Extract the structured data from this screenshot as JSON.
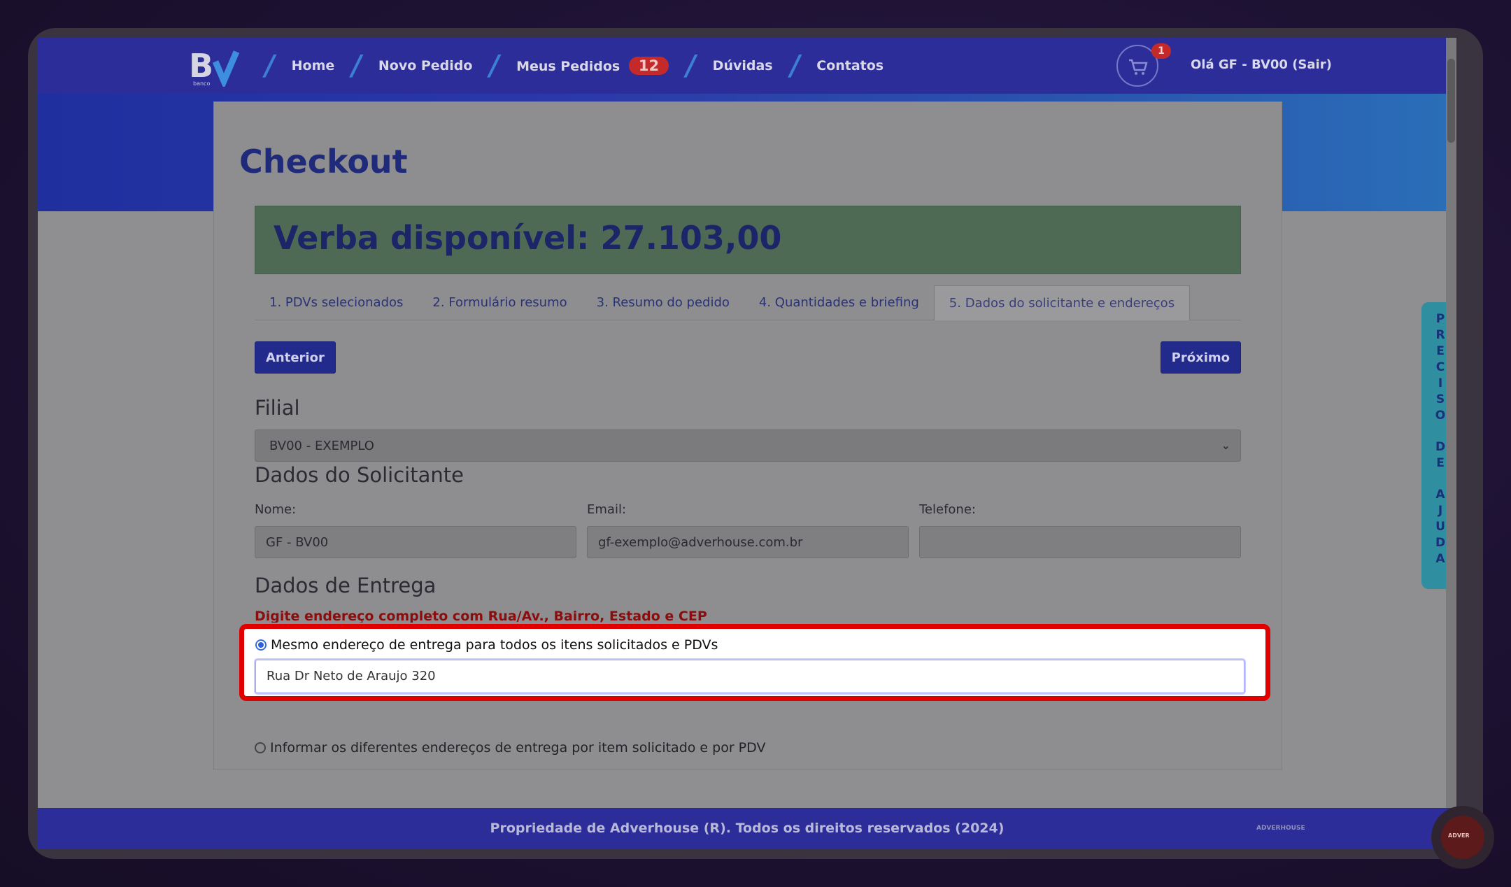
{
  "nav": {
    "logo_text": "banco",
    "items": [
      {
        "label": "Home"
      },
      {
        "label": "Novo Pedido"
      },
      {
        "label": "Meus Pedidos",
        "badge": "12"
      },
      {
        "label": "Dúvidas"
      },
      {
        "label": "Contatos"
      }
    ],
    "cart_count": "1",
    "greeting": "Olá GF - BV00 (Sair)"
  },
  "page": {
    "title": "Checkout",
    "verba": "Verba disponível: 27.103,00",
    "tabs": [
      "1. PDVs selecionados",
      "2. Formulário resumo",
      "3. Resumo do pedido",
      "4. Quantidades e briefing",
      "5. Dados do solicitante e endereços"
    ],
    "active_tab": 4,
    "prev_label": "Anterior",
    "next_label": "Próximo"
  },
  "filial": {
    "heading": "Filial",
    "selected": "BV00 - EXEMPLO"
  },
  "solicitante": {
    "heading": "Dados do Solicitante",
    "nome_label": "Nome:",
    "nome_value": "GF - BV00",
    "email_label": "Email:",
    "email_value": "gf-exemplo@adverhouse.com.br",
    "telefone_label": "Telefone:",
    "telefone_value": ""
  },
  "entrega": {
    "heading": "Dados de Entrega",
    "warning": "Digite endereço completo com Rua/Av., Bairro, Estado e CEP",
    "option_same": "Mesmo endereço de entrega para todos os itens solicitados e PDVs",
    "address_value": "Rua Dr Neto de Araujo 320",
    "option_different": "Informar os diferentes endereços de entrega por item solicitado e por PDV"
  },
  "help_tab": "PRECISO DE AJUDA",
  "footer": {
    "text": "Propriedade de Adverhouse (R). Todos os direitos reservados (2024)",
    "logo_text": "ADVERHOUSE"
  },
  "chat_widget": {
    "label": "ADVER"
  },
  "colors": {
    "nav_bg": "#2d2d99",
    "highlight_border": "#e00000",
    "primary_button": "#222b8c",
    "verba_bg": "#4e6a55"
  }
}
